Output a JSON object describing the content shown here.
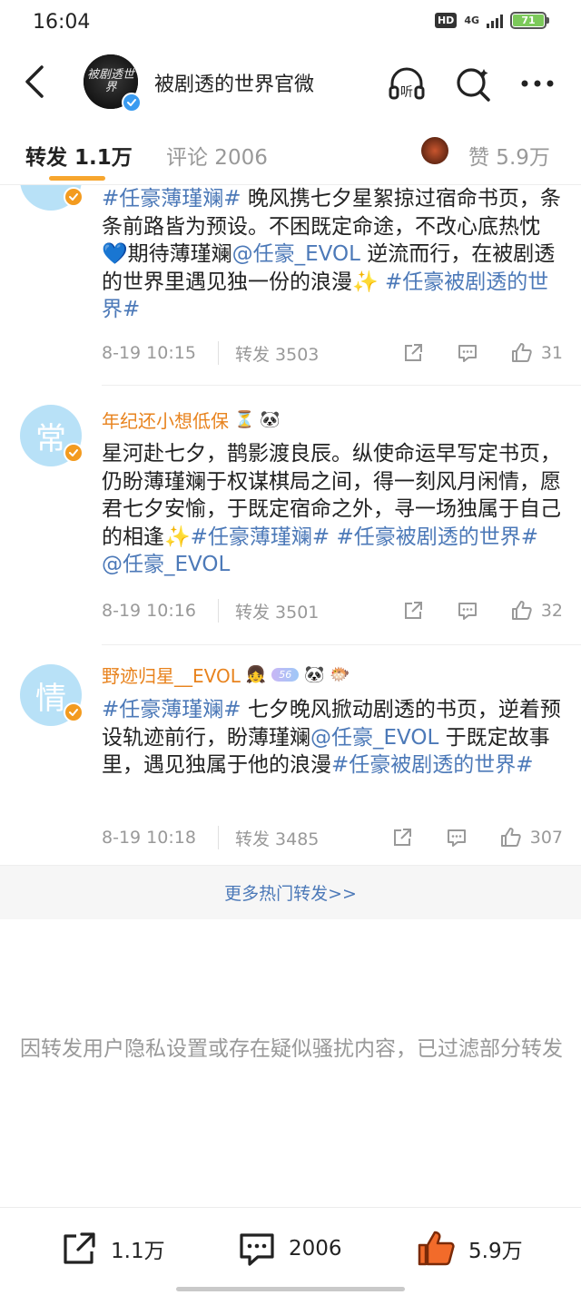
{
  "status_bar": {
    "time": "16:04",
    "hd_label": "HD",
    "network": "4G",
    "battery": "71"
  },
  "header": {
    "title": "被剧透的世界官微",
    "avatar_text": "被剧透世界"
  },
  "tabs": {
    "repost": "转发 1.1万",
    "comments": "评论 2006",
    "likes": "赞 5.9万"
  },
  "posts": [
    {
      "author": "",
      "body": [
        {
          "t": "topic",
          "v": "#任豪薄瑾斓#"
        },
        {
          "t": "text",
          "v": " 晚风携七夕星絮掠过宿命书页，条条前路皆为预设。不困既定命途，不改心底热忱💙期待薄瑾斓"
        },
        {
          "t": "mention",
          "v": "@任豪_EVOL"
        },
        {
          "t": "text",
          "v": " 逆流而行，在被剧透的世界里遇见独一份的浪漫✨ "
        },
        {
          "t": "topic",
          "v": "#任豪被剧透的世界#"
        }
      ],
      "time": "8-19 10:15",
      "reposts": "转发 3503",
      "likes": "31"
    },
    {
      "author": "年纪还小想低保",
      "author_emoji": "⏳ 🐼",
      "avatar_glyph": "常",
      "body": [
        {
          "t": "text",
          "v": "星河赴七夕，鹊影渡良辰。纵使命运早写定书页，仍盼薄瑾斓于权谋棋局之间，得一刻风月闲情，愿君七夕安愉，于既定宿命之外，寻一场独属于自己的相逢✨"
        },
        {
          "t": "topic",
          "v": "#任豪薄瑾斓#"
        },
        {
          "t": "text",
          "v": " "
        },
        {
          "t": "topic",
          "v": "#任豪被剧透的世界#"
        },
        {
          "t": "text",
          "v": " "
        },
        {
          "t": "mention",
          "v": "@任豪_EVOL"
        }
      ],
      "time": "8-19 10:16",
      "reposts": "转发 3501",
      "likes": "32"
    },
    {
      "author": "野迹归星__EVOL",
      "author_emoji": "👧",
      "vip_label": "56",
      "author_emoji_after": "🐼 🐡",
      "avatar_glyph": "情",
      "body": [
        {
          "t": "topic",
          "v": "#任豪薄瑾斓#"
        },
        {
          "t": "text",
          "v": " 七夕晚风掀动剧透的书页，逆着预设轨迹前行，盼薄瑾斓"
        },
        {
          "t": "mention",
          "v": "@任豪_EVOL"
        },
        {
          "t": "text",
          "v": " 于既定故事里，遇见独属于他的浪漫"
        },
        {
          "t": "topic",
          "v": "#任豪被剧透的世界#"
        }
      ],
      "time": "8-19 10:18",
      "reposts": "转发 3485",
      "likes": "307"
    }
  ],
  "more_reposts": "更多热门转发>>",
  "notice": "因转发用户隐私设置或存在疑似骚扰内容，已过滤部分转发",
  "toolbar": {
    "repost": "1.1万",
    "comment": "2006",
    "like": "5.9万"
  },
  "colors": {
    "accent": "#f7a62e",
    "link": "#4c79b8",
    "author": "#e8831e",
    "like_active": "#f26b2a"
  }
}
